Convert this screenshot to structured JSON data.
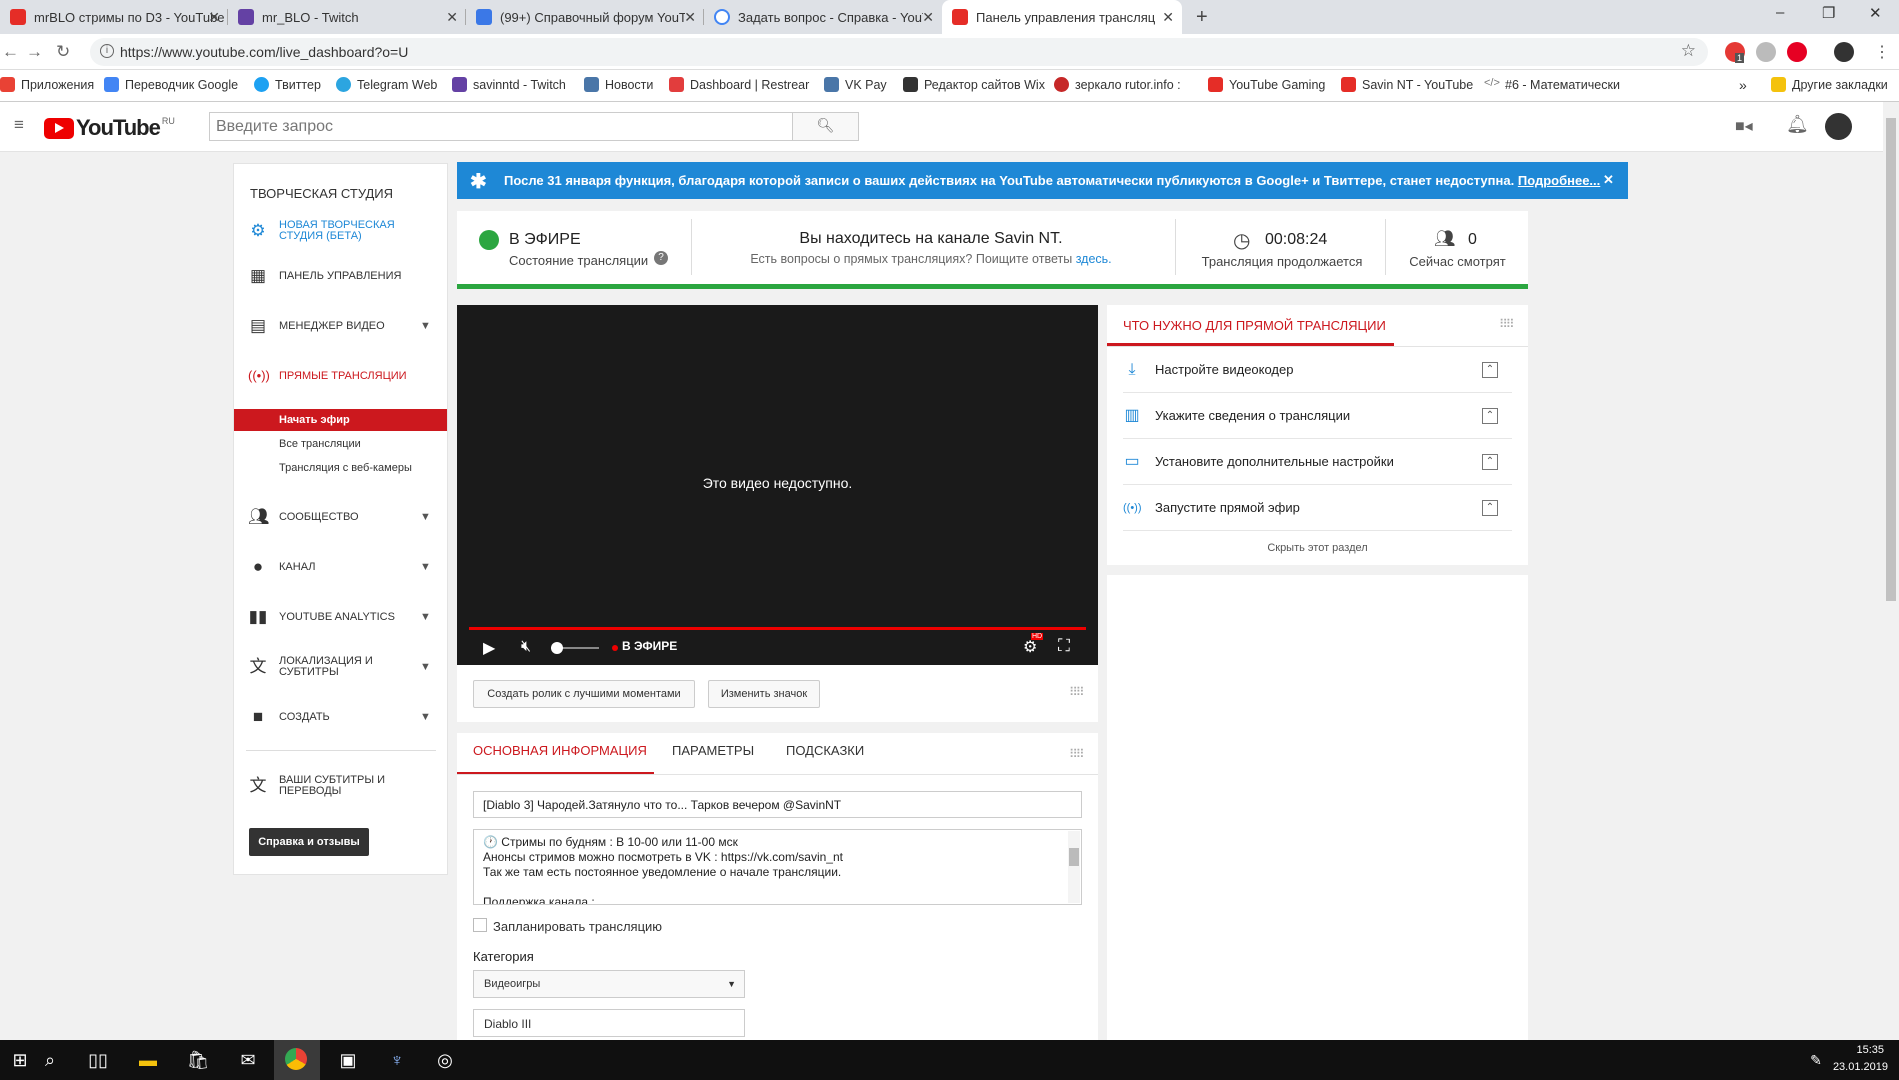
{
  "browser": {
    "tabs": [
      {
        "title": "mrBLO стримы по D3 - YouTube",
        "icon": "youtube-icon",
        "color": "#e52d27"
      },
      {
        "title": "mr_BLO - Twitch",
        "icon": "twitch-icon",
        "color": "#6441a4"
      },
      {
        "title": "(99+) Справочный форум YouT",
        "icon": "forum-icon",
        "color": "#3b78e7"
      },
      {
        "title": "Задать вопрос - Справка - YouT",
        "icon": "google-icon",
        "color": "#4285f4"
      },
      {
        "title": "Панель управления трансляц",
        "icon": "youtube-icon",
        "color": "#e52d27"
      }
    ],
    "new_tab": "+",
    "window_controls": {
      "minimize": "–",
      "maximize": "❐",
      "close": "✕"
    },
    "address": "https://www.youtube.com/live_dashboard?o=U",
    "extensions": {
      "adblock_badge": "1"
    },
    "bookmarks": [
      {
        "label": "Приложения",
        "icon": "apps-icon",
        "color": "#e94235"
      },
      {
        "label": "Переводчик Google",
        "icon": "translate-icon",
        "color": "#4285f4"
      },
      {
        "label": "Твиттер",
        "icon": "twitter-icon",
        "color": "#1da1f2"
      },
      {
        "label": "Telegram Web",
        "icon": "telegram-icon",
        "color": "#2ca5e0"
      },
      {
        "label": "savinntd - Twitch",
        "icon": "twitch-icon",
        "color": "#6441a4"
      },
      {
        "label": "Новости",
        "icon": "vk-icon",
        "color": "#4a76a8"
      },
      {
        "label": "Dashboard | Restrear",
        "icon": "restream-icon",
        "color": "#e23d3d"
      },
      {
        "label": "VK Pay",
        "icon": "vk-icon",
        "color": "#4a76a8"
      },
      {
        "label": "Редактор сайтов Wix",
        "icon": "wix-icon",
        "color": "#333333"
      },
      {
        "label": "зеркало rutor.info :",
        "icon": "rutor-icon",
        "color": "#c62828"
      },
      {
        "label": "YouTube Gaming",
        "icon": "yt-gaming-icon",
        "color": "#e52d27"
      },
      {
        "label": "Savin NT - YouTube",
        "icon": "youtube-icon",
        "color": "#e52d27"
      },
      {
        "label": "#6 - Математически",
        "icon": "code-icon",
        "color": "#777777"
      }
    ],
    "bookmarks_overflow": "»",
    "other_bookmarks": "Другие закладки"
  },
  "youtube": {
    "logo": "YouTube",
    "region": "RU",
    "search_placeholder": "Введите запрос"
  },
  "sidebar": {
    "title": "ТВОРЧЕСКАЯ СТУДИЯ",
    "items": [
      {
        "label": "НОВАЯ ТВОРЧЕСКАЯ СТУДИЯ (БЕТА)",
        "icon": "gear-icon"
      },
      {
        "label": "ПАНЕЛЬ УПРАВЛЕНИЯ",
        "icon": "dashboard-icon"
      },
      {
        "label": "МЕНЕДЖЕР ВИДЕО",
        "icon": "video-manager-icon"
      },
      {
        "label": "ПРЯМЫЕ ТРАНСЛЯЦИИ",
        "icon": "live-icon"
      },
      {
        "label": "СООБЩЕСТВО",
        "icon": "community-icon"
      },
      {
        "label": "КАНАЛ",
        "icon": "channel-icon"
      },
      {
        "label": "YOUTUBE ANALYTICS",
        "icon": "analytics-icon"
      },
      {
        "label": "ЛОКАЛИЗАЦИЯ И СУБТИТРЫ",
        "icon": "translate-icon"
      },
      {
        "label": "СОЗДАТЬ",
        "icon": "create-icon"
      },
      {
        "label": "ВАШИ СУБТИТРЫ И ПЕРЕВОДЫ",
        "icon": "subtitles-icon"
      }
    ],
    "sub_items": [
      "Начать эфир",
      "Все трансляции",
      "Трансляция с веб-камеры"
    ],
    "help_button": "Справка и отзывы"
  },
  "banner": {
    "text": "После 31 января функция, благодаря которой записи о ваших действиях на YouTube автоматически публикуются в Google+ и Твиттере, станет недоступна.",
    "link": "Подробнее...",
    "close": "✕"
  },
  "status": {
    "live_label": "В ЭФИРЕ",
    "live_sub": "Состояние трансляции",
    "channel_title": "Вы находитесь на канале Savin NT.",
    "channel_sub": "Есть вопросы о прямых трансляциях? Поищите ответы",
    "channel_link": "здесь.",
    "duration": "00:08:24",
    "duration_label": "Трансляция продолжается",
    "viewers": "0",
    "viewers_label": "Сейчас смотрят",
    "live_color": "#2ba640"
  },
  "player": {
    "message": "Это видео недоступно.",
    "live_badge": "В ЭФИРЕ",
    "hd": "HD"
  },
  "actions": {
    "highlights": "Создать ролик с лучшими моментами",
    "thumbnail": "Изменить значок"
  },
  "info": {
    "tabs": [
      "ОСНОВНАЯ ИНФОРМАЦИЯ",
      "ПАРАМЕТРЫ",
      "ПОДСКАЗКИ"
    ],
    "title_value": "[Diablo 3] Чародей.Затянуло что то... Тарков вечером @SavinNT",
    "description_lines": [
      "🕐 Стримы по будням : В 10-00 или 11-00 мск",
      "Анонсы стримов можно посмотреть в VK : https://vk.com/savin_nt",
      "Так же там есть постоянное уведомление о начале трансляции.",
      "",
      "Поддержка канала :"
    ],
    "schedule_label": "Запланировать трансляцию",
    "category_label": "Категория",
    "category_value": "Видеоигры",
    "game_value": "Diablo III"
  },
  "checklist": {
    "title": "ЧТО НУЖНО ДЛЯ ПРЯМОЙ ТРАНСЛЯЦИИ",
    "items": [
      {
        "label": "Настройте видеокодер",
        "icon": "download-icon"
      },
      {
        "label": "Укажите сведения о трансляции",
        "icon": "chart-icon"
      },
      {
        "label": "Установите дополнительные настройки",
        "icon": "card-icon"
      },
      {
        "label": "Запустите прямой эфир",
        "icon": "live-icon"
      }
    ],
    "hide": "Скрыть этот раздел"
  },
  "taskbar": {
    "time": "15:35",
    "date": "23.01.2019"
  }
}
